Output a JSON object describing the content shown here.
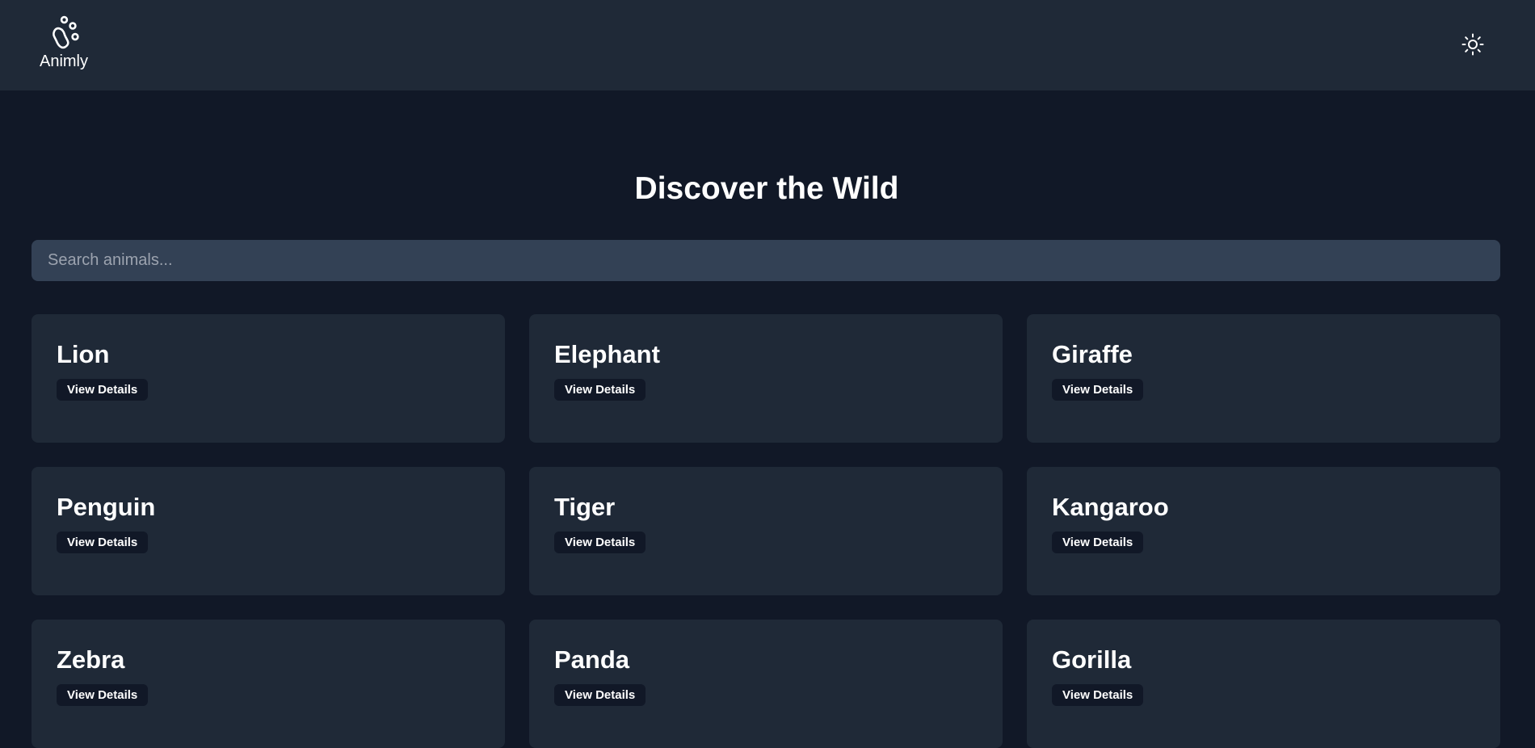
{
  "header": {
    "brand_name": "Animly",
    "logo_icon": "paw-icon",
    "theme_toggle_icon": "sun-icon"
  },
  "main": {
    "title": "Discover the Wild",
    "search": {
      "placeholder": "Search animals...",
      "value": ""
    },
    "cards": [
      {
        "name": "Lion",
        "button_label": "View Details"
      },
      {
        "name": "Elephant",
        "button_label": "View Details"
      },
      {
        "name": "Giraffe",
        "button_label": "View Details"
      },
      {
        "name": "Penguin",
        "button_label": "View Details"
      },
      {
        "name": "Tiger",
        "button_label": "View Details"
      },
      {
        "name": "Kangaroo",
        "button_label": "View Details"
      },
      {
        "name": "Zebra",
        "button_label": "View Details"
      },
      {
        "name": "Panda",
        "button_label": "View Details"
      },
      {
        "name": "Gorilla",
        "button_label": "View Details"
      }
    ]
  },
  "colors": {
    "page_background": "#111827",
    "header_background": "#1f2937",
    "card_background": "#1f2937",
    "search_background": "#334155",
    "button_background": "#111827",
    "text": "#ffffff",
    "placeholder": "#9ca3af"
  }
}
